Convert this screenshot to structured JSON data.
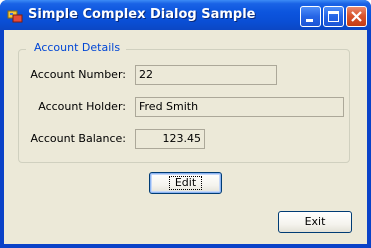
{
  "window": {
    "title": "Simple Complex Dialog Sample"
  },
  "group": {
    "legend": "Account Details"
  },
  "fields": {
    "account_number": {
      "label": "Account Number:",
      "value": "22"
    },
    "account_holder": {
      "label": "Account Holder:",
      "value": "Fred Smith"
    },
    "account_balance": {
      "label": "Account Balance:",
      "value": "123.45"
    }
  },
  "buttons": {
    "edit": "Edit",
    "exit": "Exit"
  },
  "icons": {
    "app": "app-icon",
    "minimize": "minimize-icon",
    "maximize": "maximize-icon",
    "close": "close-icon"
  },
  "colors": {
    "titlebar": "#0a4fd6",
    "client_bg": "#ece9d8",
    "legend_text": "#0046d5",
    "close_button": "#d9552e"
  }
}
